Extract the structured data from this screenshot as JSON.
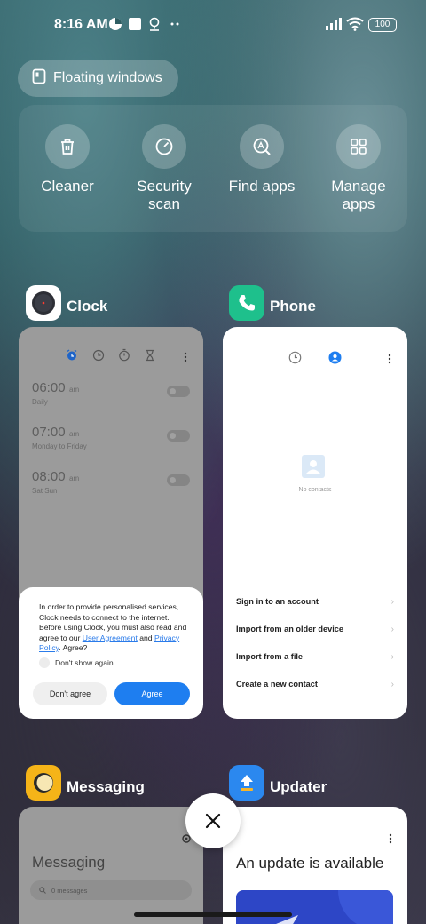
{
  "status_bar": {
    "time": "8:16 AM",
    "battery": "100"
  },
  "floating_windows": {
    "label": "Floating windows",
    "icon": "floating-window-icon"
  },
  "tools": [
    {
      "label": "Cleaner",
      "icon": "trash-icon"
    },
    {
      "label": "Security scan",
      "icon": "security-scan-icon"
    },
    {
      "label": "Find apps",
      "icon": "find-apps-icon"
    },
    {
      "label": "Manage apps",
      "icon": "grid-icon"
    }
  ],
  "apps": {
    "clock": {
      "name": "Clock",
      "alarms": [
        {
          "time": "06:00",
          "ampm": "am",
          "sub": "Daily"
        },
        {
          "time": "07:00",
          "ampm": "am",
          "sub": "Monday to Friday"
        },
        {
          "time": "08:00",
          "ampm": "am",
          "sub": "Sat Sun"
        }
      ],
      "dialog": {
        "text_1": "In order to provide personalised services, Clock needs to connect to the internet. Before using Clock, you must also read and agree to our ",
        "link_user_agreement": "User Agreement",
        "text_and": " and ",
        "link_privacy": "Privacy Policy",
        "text_end": ". Agree?",
        "checkbox_label": "Don't show again",
        "disagree": "Don't agree",
        "agree": "Agree"
      }
    },
    "phone": {
      "name": "Phone",
      "empty_text": "No contacts",
      "options": [
        "Sign in to an account",
        "Import from an older device",
        "Import from a file",
        "Create a new contact"
      ]
    },
    "messaging": {
      "name": "Messaging",
      "title": "Messaging",
      "search_placeholder": "0 messages"
    },
    "updater": {
      "name": "Updater",
      "title": "An update is available"
    }
  },
  "colors": {
    "accent_blue": "#1e7ef0",
    "phone_icon_bg": "#1ec08c",
    "messaging_icon_bg": "#f5b418",
    "updater_icon_bg": "#2b88ef"
  }
}
